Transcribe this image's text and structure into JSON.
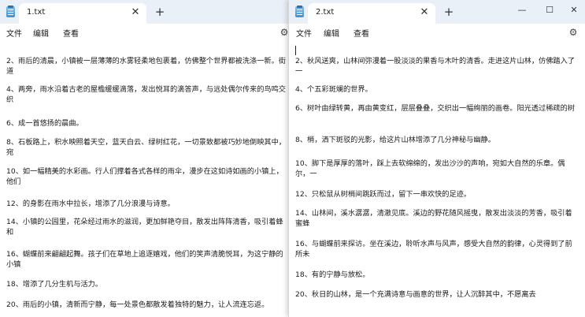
{
  "left_window": {
    "tab_title": "1.txt",
    "menu": [
      "文件",
      "编辑",
      "查看"
    ],
    "lines": [
      "2、雨后的清晨，小镇被一层薄薄的水雾轻柔地包裹着，仿佛整个世界都被洗涤一新。街道",
      "4、两旁，雨水沿着古老的屋檐缓缓滴落，发出悦耳的滴答声，与远处偶尔传来的鸟鸣交织",
      "6、成一首悠扬的晨曲。",
      "8、石板路上，积水映照着天空，蓝天白云、绿树红花，一切景致都被巧妙地倒映其中，宛",
      "10、如一幅精美的水彩画。行人们撑着各式各样的雨伞，漫步在这如诗如画的小镇上，他们",
      "12、的身影在雨水中拉长，增添了几分浪漫与诗意。",
      "14、小镇的公园里，花朵经过雨水的滋润，更加鲜艳夺目，散发出阵阵清香，吸引着蜂和",
      "16、蝴蝶前来翩翩起舞。孩子们在草地上追逐嬉戏，他们的笑声清脆悦耳，为这宁静的小镇",
      "18、增添了几分生机与活力。",
      "20、雨后的小镇，清新而宁静，每一处景色都散发着独特的魅力，让人流连忘返。"
    ]
  },
  "right_window": {
    "tab_title": "2.txt",
    "menu": [
      "文件",
      "编辑",
      "查看"
    ],
    "lines": [
      "2、秋风送爽，山林间弥漫着一股淡淡的果香与木叶的清香。走进这片山林，仿佛踏入了一",
      "4、个五彩斑斓的世界。",
      "6、树叶由绿转黄，再由黄变红，层层叠叠，交织出一幅绚丽的画卷。阳光透过稀疏的树",
      "8、梢，洒下斑驳的光影，给这片山林增添了几分神秘与幽静。",
      "10、脚下是厚厚的落叶，踩上去软绵绵的，发出沙沙的声响，宛如大自然的乐章。偶尔，一",
      "12、只松鼠从树梢间跳跃而过，留下一串欢快的足迹。",
      "14、山林间，溪水潺潺，清澈见底。溪边的野花随风摇曳，散发出淡淡的芳香，吸引着蜜蜂",
      "16、与蝴蝶前来探访。坐在溪边，聆听水声与风声，感受大自然的韵律，心灵得到了前所未",
      "18、有的宁静与放松。",
      "20、秋日的山林，是一个充满诗意与画意的世界，让人沉醉其中，不愿离去"
    ]
  },
  "icons": {
    "close": "✕",
    "plus": "+",
    "minimize": "—",
    "maximize": "☐",
    "settings": "⚙"
  }
}
